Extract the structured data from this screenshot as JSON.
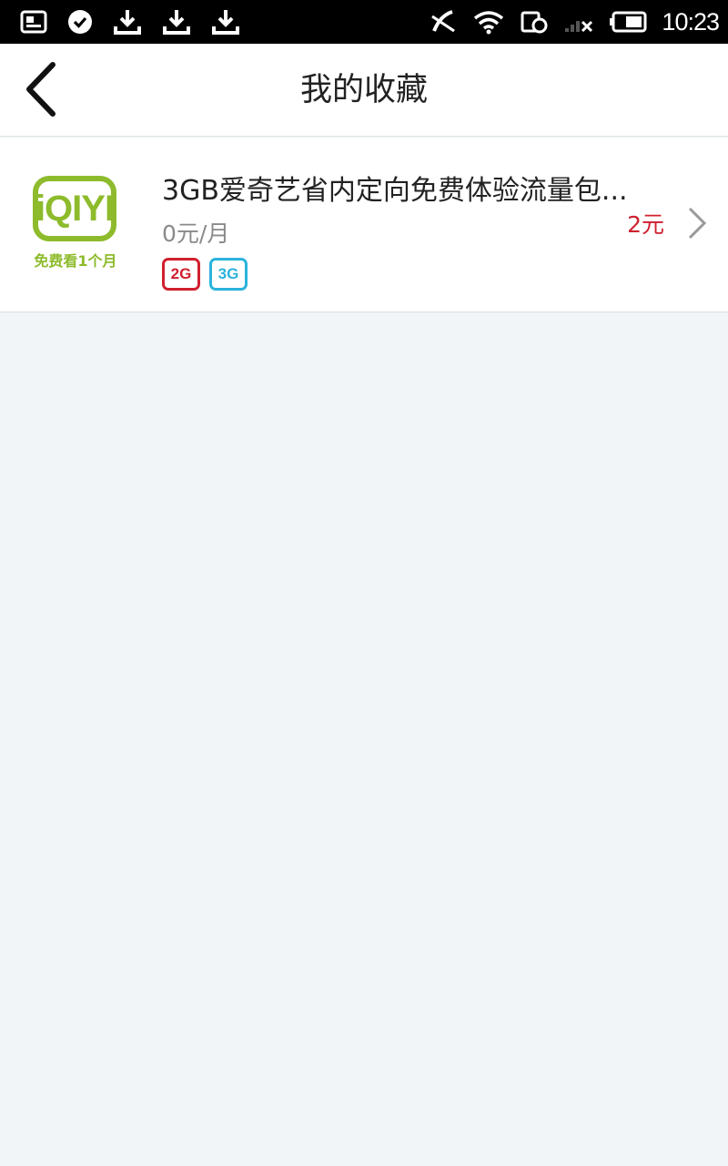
{
  "status_bar": {
    "time": "10:23",
    "left_icons": [
      "image-notification-icon",
      "check-circle-icon",
      "download-icon",
      "download-icon",
      "download-icon"
    ],
    "right_icons": [
      "phone-muted-icon",
      "wifi-icon",
      "alarm-icon",
      "no-signal-icon",
      "battery-icon"
    ]
  },
  "header": {
    "title": "我的收藏"
  },
  "favorites": [
    {
      "logo_text": "iQIYI",
      "logo_caption": "免费看1个月",
      "title": "3GB爱奇艺省内定向免费体验流量包...",
      "subtitle": "0元/月",
      "price": "2元",
      "tags": [
        "2G",
        "3G"
      ]
    }
  ],
  "colors": {
    "accent_red": "#d0202f",
    "tag_blue": "#2bb3dc",
    "logo_green": "#8dbb2c",
    "background": "#f1f5f7"
  }
}
